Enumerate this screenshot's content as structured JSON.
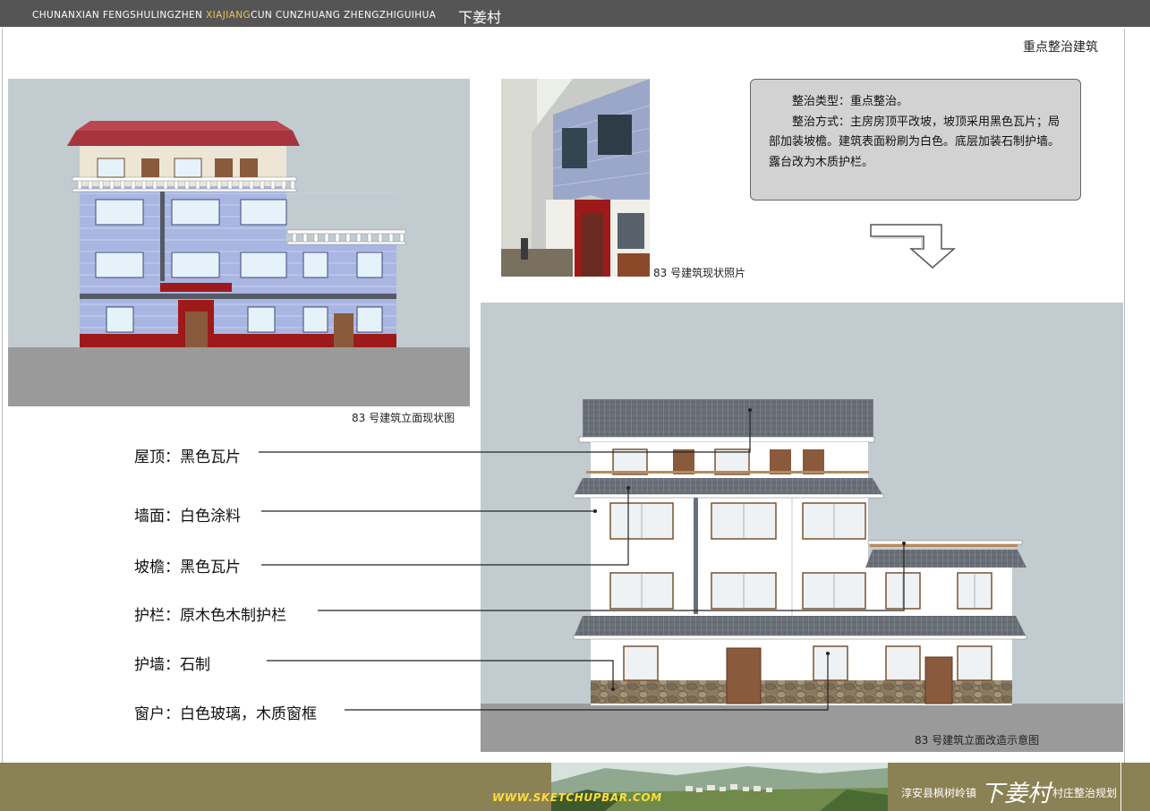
{
  "header": {
    "pinyin_before": "CHUNANXIAN  FENGSHULINGZHEN  ",
    "pinyin_highlight": "XIAJIANG",
    "pinyin_after": "CUN  CUNZHUANG ZHENGZHIGUIHUA",
    "village_name": "下姜村"
  },
  "section_title": "重点整治建筑",
  "captions": {
    "current_elevation": "83 号建筑立面现状图",
    "current_photo": "83 号建筑现状照片",
    "renovated_elevation": "83 号建筑立面改造示意图"
  },
  "note": {
    "line1": "整治类型：重点整治。",
    "line2": "整治方式：主房房顶平改坡，坡顶采用黑色瓦片；局部加装坡檐。建筑表面粉刷为白色。底层加装石制护墙。露台改为木质护栏。"
  },
  "legend": [
    {
      "text": "屋顶：黑色瓦片"
    },
    {
      "text": "墙面：白色涂料"
    },
    {
      "text": "坡檐：黑色瓦片"
    },
    {
      "text": "护栏：原木色木制护栏"
    },
    {
      "text": "护墙：石制"
    },
    {
      "text": "窗户：白色玻璃，木质窗框"
    }
  ],
  "footer": {
    "website": "WWW.SKETCHUPBAR.COM",
    "county": "淳安县枫树岭镇",
    "logo_text": "下姜村",
    "plan_text": "村庄整治规划"
  },
  "colors": {
    "header_bg": "#555555",
    "header_highlight": "#e8c35a",
    "footer_bg": "#8a8154",
    "site_text": "#ffde3a",
    "panel_sky": "#c2ccd0",
    "ground": "#9a9a9a",
    "old_wall": "#a9b6e2",
    "old_base": "#9e1a1a",
    "old_roof": "#a6343f",
    "tile_dark": "#6a6f78",
    "stone": "#8b7a62",
    "door_wood": "#8a5a3c"
  }
}
